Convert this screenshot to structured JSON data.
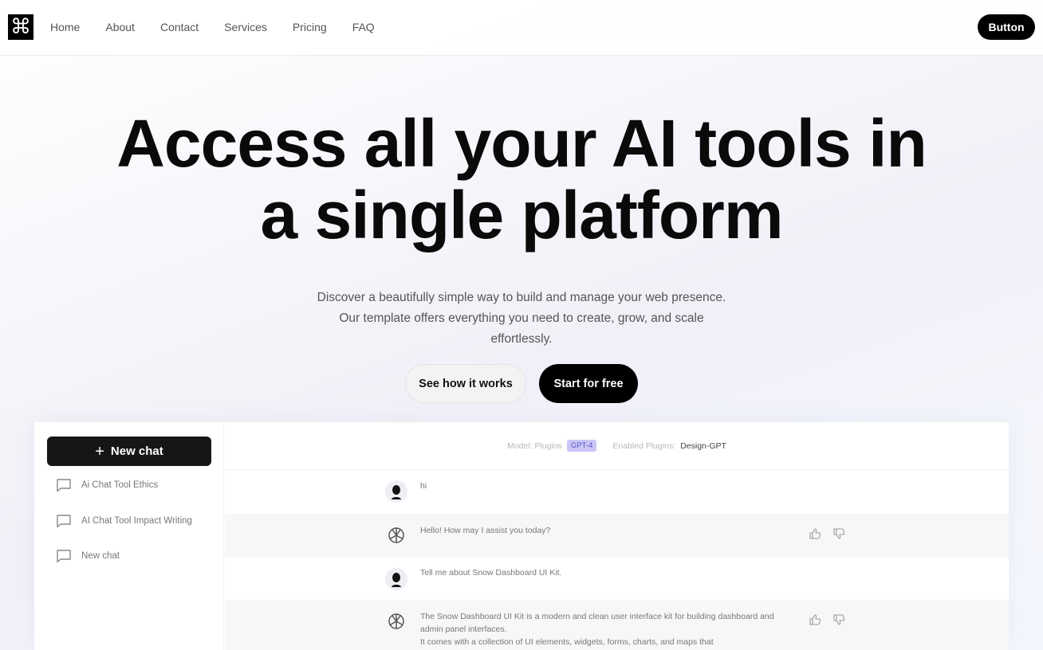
{
  "nav": {
    "logo_glyph": "⌘",
    "links": [
      "Home",
      "About",
      "Contact",
      "Services",
      "Pricing",
      "FAQ"
    ],
    "cta_label": "Button"
  },
  "hero": {
    "title_line1": "Access all your AI tools in",
    "title_line2": "a single platform",
    "subtitle": "Discover a beautifully simple way to build and manage your web presence. Our template offers everything you need to create, grow, and scale effortlessly.",
    "secondary_cta": "See how it works",
    "primary_cta": "Start for free"
  },
  "app": {
    "new_chat_label": "New chat",
    "new_chat_icon": "plus-icon",
    "history": [
      {
        "label": "Ai Chat Tool Ethics",
        "icon": "chat-bubble-icon"
      },
      {
        "label": "AI Chat Tool Impact Writing",
        "icon": "chat-bubble-icon"
      },
      {
        "label": "New chat",
        "icon": "chat-bubble-icon"
      }
    ],
    "header": {
      "model_label": "Model: Plugins",
      "model_badge": "GPT-4",
      "plugins_label": "Enabled Plugins:",
      "plugins_value": "Design-GPT"
    },
    "messages": [
      {
        "role": "user",
        "text": "hi"
      },
      {
        "role": "assistant",
        "text": "Hello! How may I assist you today?"
      },
      {
        "role": "user",
        "text": "Tell me about Snow Dashboard UI Kit."
      },
      {
        "role": "assistant",
        "text": "The Snow Dashboard UI Kit is a modern and clean user interface kit for building dashboard and admin panel interfaces.",
        "text2": "It comes with a collection of UI elements, widgets, forms, charts, and maps that"
      }
    ],
    "accent_color": "#c9c6f5"
  }
}
